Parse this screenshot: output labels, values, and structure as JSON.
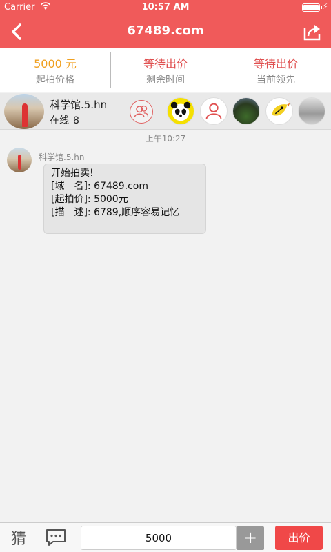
{
  "status": {
    "carrier": "Carrier",
    "time": "10:57 AM"
  },
  "nav": {
    "title": "67489.com"
  },
  "stats": [
    {
      "value": "5000 元",
      "label": "起拍价格"
    },
    {
      "value": "等待出价",
      "label": "剩余时间"
    },
    {
      "value": "等待出价",
      "label": "当前领先"
    }
  ],
  "user": {
    "name": "科学馆.5.hn",
    "online_label": "在线",
    "online_count": "8"
  },
  "chat": {
    "time": "上午10:27",
    "sender": "科学馆.5.hn",
    "lines": [
      "开始拍卖!",
      "[域　名]: 67489.com",
      "[起拍价]: 5000元",
      "[描　述]: 6789,顺序容易记忆"
    ]
  },
  "bottom": {
    "guess_label": "猜",
    "bid_value": "5000",
    "plus_label": "+",
    "bid_button": "出价"
  },
  "colors": {
    "brand": "#f05a5a",
    "price": "#f0a020",
    "status": "#e05050",
    "bid_button": "#f04848"
  }
}
